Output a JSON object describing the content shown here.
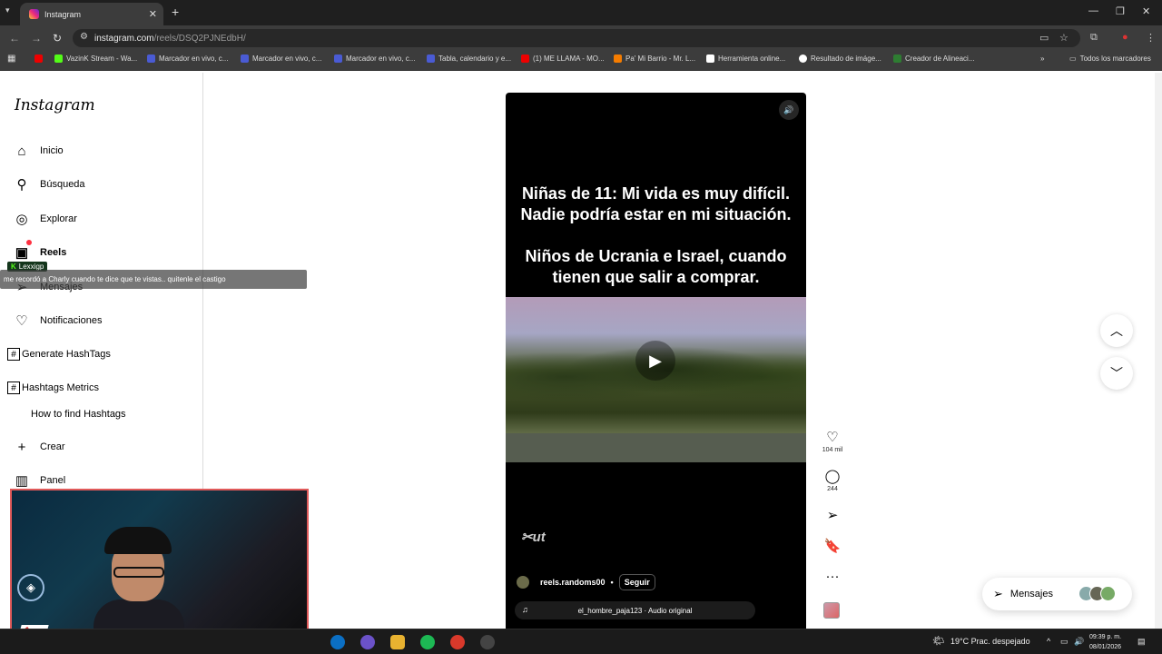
{
  "browser": {
    "tab_title": "Instagram",
    "url_host": "instagram.com",
    "url_path": "/reels/DSQ2PJNEdbH/",
    "bookmarks": [
      "VazinK Stream - Wa...",
      "Marcador en vivo, c...",
      "Marcador en vivo, c...",
      "Marcador en vivo, c...",
      "Tabla, calendario y e...",
      "(1) ME LLAMA - MO...",
      "Pa' Mi Barrio - Mr. L...",
      "Herramienta online...",
      "Resultado de imáge...",
      "Creador de Alineaci...",
      "Todos los marcadores"
    ]
  },
  "sidebar": {
    "logo": "Instagram",
    "items": [
      {
        "label": "Inicio",
        "icon": "home-icon"
      },
      {
        "label": "Búsqueda",
        "icon": "search-icon"
      },
      {
        "label": "Explorar",
        "icon": "compass-icon"
      },
      {
        "label": "Reels",
        "icon": "reels-icon"
      },
      {
        "label": "Mensajes",
        "icon": "send-icon"
      },
      {
        "label": "Notificaciones",
        "icon": "heart-icon"
      },
      {
        "label": "Generate HashTags",
        "icon": "hashtag-icon"
      },
      {
        "label": "Hashtags Metrics",
        "icon": "hashtag-icon"
      },
      {
        "label": "How to find Hashtags",
        "icon": ""
      },
      {
        "label": "Crear",
        "icon": "plus-icon"
      },
      {
        "label": "Panel",
        "icon": "chart-icon"
      }
    ]
  },
  "overlay": {
    "chat_user": "Lexxigp",
    "chat_message": "me recordó a Charly cuando te dice que te vistas.. quitenle el castigo"
  },
  "reel": {
    "caption_line1": "Niñas de 11: Mi vida es muy difícil.",
    "caption_line2": "Nadie podría estar en mi situación.",
    "caption_line3": "Niños de Ucrania e Israel, cuando",
    "caption_line4": "tienen que salir a comprar.",
    "watermark": "CapCut",
    "author": "reels.randoms00",
    "follow_label": "Seguir",
    "audio": "el_hombre_paja123 · Audio original"
  },
  "actions": {
    "likes": "104 mil",
    "comments": "244"
  },
  "messages_pill": {
    "label": "Mensajes"
  },
  "taskbar": {
    "weather": "19°C  Prac. despejado",
    "time": "09:39 p. m.",
    "date": "08/01/2026"
  }
}
